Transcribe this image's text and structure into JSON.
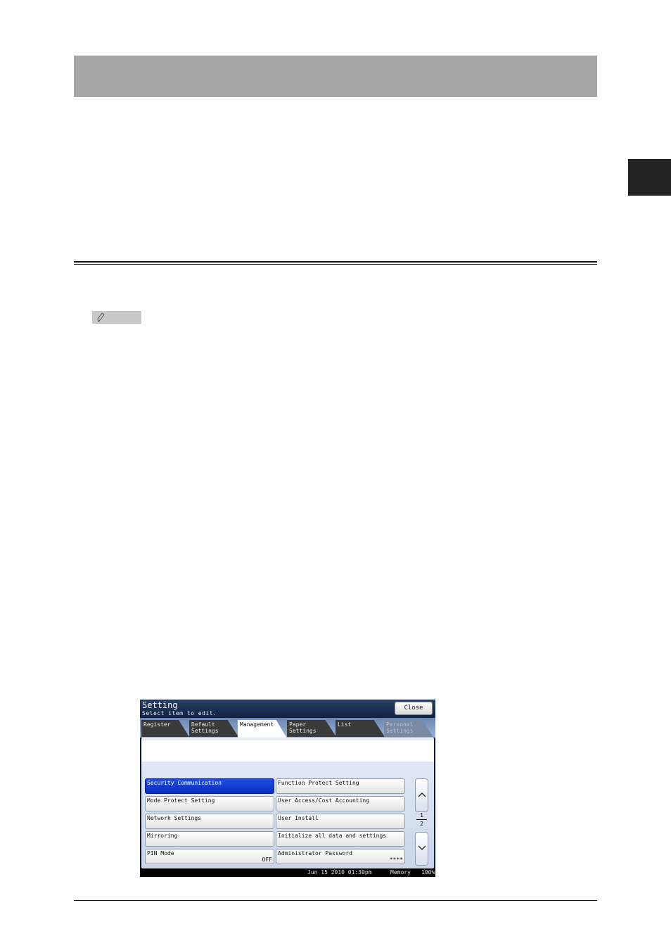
{
  "screen": {
    "title": "Setting",
    "subtitle": "Select item to edit.",
    "close_label": "Close",
    "tabs": [
      {
        "label": "Register"
      },
      {
        "label": "Default Settings"
      },
      {
        "label": "Management"
      },
      {
        "label": "Paper Settings"
      },
      {
        "label": "List"
      },
      {
        "label": "Personal Settings"
      }
    ],
    "items": [
      {
        "label": "Security Communication",
        "value": ""
      },
      {
        "label": "Function Protect Setting",
        "value": ""
      },
      {
        "label": "Mode Protect Setting",
        "value": ""
      },
      {
        "label": "User Access/Cost Accounting",
        "value": ""
      },
      {
        "label": "Network Settings",
        "value": ""
      },
      {
        "label": "User Install",
        "value": ""
      },
      {
        "label": "Mirroring",
        "value": ""
      },
      {
        "label": "Initialize all data and settings",
        "value": ""
      },
      {
        "label": "PIN Mode",
        "value": "OFF"
      },
      {
        "label": "Administrator Password",
        "value": "****"
      }
    ],
    "page": {
      "current": "1",
      "total": "2"
    },
    "status": {
      "date": "Jun 15 2010 01:30pm",
      "memory": "Memory",
      "percent": "100%"
    }
  }
}
